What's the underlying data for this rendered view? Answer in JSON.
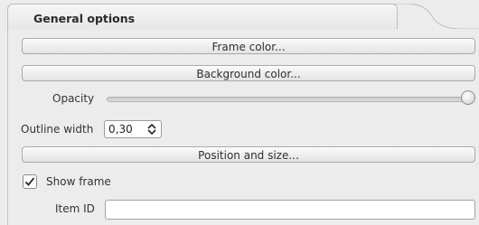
{
  "group": {
    "title": "General options"
  },
  "buttons": {
    "frame_color": "Frame color...",
    "background_color": "Background color...",
    "position_and_size": "Position and size..."
  },
  "opacity": {
    "label": "Opacity",
    "value_fraction": 1.0
  },
  "outline_width": {
    "label": "Outline width",
    "value": "0,30"
  },
  "show_frame": {
    "label": "Show frame",
    "checked": true
  },
  "item_id": {
    "label": "Item ID",
    "value": ""
  },
  "icons": {
    "spin_arrows": "up-down-arrows-icon",
    "checkmark": "checkmark-icon"
  }
}
